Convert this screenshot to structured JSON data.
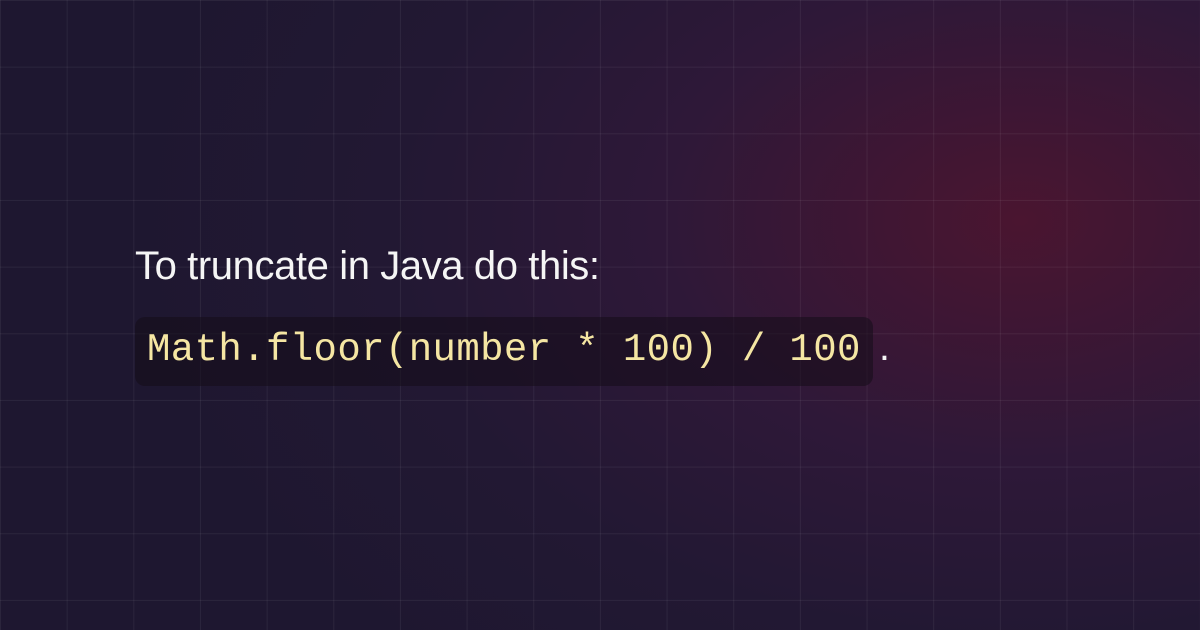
{
  "heading": "To truncate in Java do this:",
  "code": "Math.floor(number * 100) / 100",
  "period": ".",
  "colors": {
    "bg_deep": "#1e1730",
    "bg_glow": "#4a1530",
    "grid_line": "rgba(255,255,255,0.06)",
    "text": "#f5f5f5",
    "code_text": "#f5e6a3",
    "code_bg": "rgba(20,12,24,0.55)"
  }
}
